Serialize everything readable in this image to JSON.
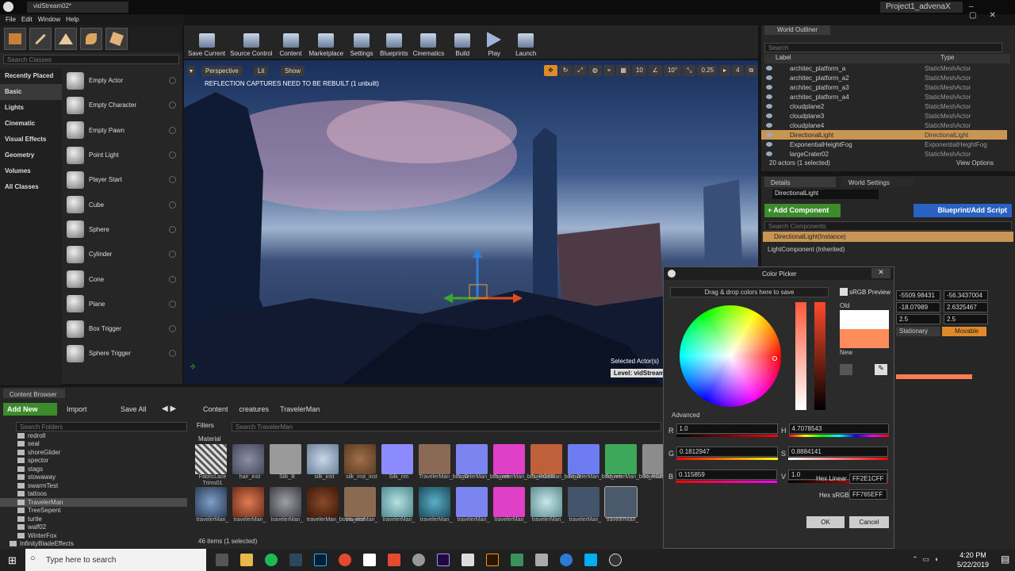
{
  "window": {
    "tab_title": "vidStream02*",
    "project": "Project1_advenaX"
  },
  "menu": [
    "File",
    "Edit",
    "Window",
    "Help"
  ],
  "place": {
    "search_placeholder": "Search Classes",
    "categories": [
      "Recently Placed",
      "Basic",
      "Lights",
      "Cinematic",
      "Visual Effects",
      "Geometry",
      "Volumes",
      "All Classes"
    ],
    "items": [
      "Empty Actor",
      "Empty Character",
      "Empty Pawn",
      "Point Light",
      "Player Start",
      "Cube",
      "Sphere",
      "Cylinder",
      "Cone",
      "Plane",
      "Box Trigger",
      "Sphere Trigger"
    ]
  },
  "toolbar": [
    "Save Current",
    "Source Control",
    "Content",
    "Marketplace",
    "Settings",
    "Blueprints",
    "Cinematics",
    "Build",
    "Play",
    "Launch"
  ],
  "viewport": {
    "perspective": "Perspective",
    "lit": "Lit",
    "show": "Show",
    "warning": "REFLECTION CAPTURES NEED TO BE REBUILT (1 unbuilt)",
    "grid": "10",
    "angle": "10°",
    "scale": "0.25",
    "cam": "4",
    "selected": "Selected Actor(s)",
    "level": "Level:  vidStream"
  },
  "outliner": {
    "tab": "World Outliner",
    "search": "Search",
    "col_label": "Label",
    "col_type": "Type",
    "rows": [
      {
        "label": "architec_platform_a",
        "type": "StaticMeshActor"
      },
      {
        "label": "architec_platform_a2",
        "type": "StaticMeshActor"
      },
      {
        "label": "architec_platform_a3",
        "type": "StaticMeshActor"
      },
      {
        "label": "architec_platform_a4",
        "type": "StaticMeshActor"
      },
      {
        "label": "cloudplane2",
        "type": "StaticMeshActor"
      },
      {
        "label": "cloudplane3",
        "type": "StaticMeshActor"
      },
      {
        "label": "cloudplane4",
        "type": "StaticMeshActor"
      },
      {
        "label": "DirectionalLight",
        "type": "DirectionalLight"
      },
      {
        "label": "ExponentialHeightFog",
        "type": "ExponentialHeightFog"
      },
      {
        "label": "largeCrater02",
        "type": "StaticMeshActor"
      }
    ],
    "status": "20 actors (1 selected)",
    "view_options": "View Options"
  },
  "details": {
    "tab_details": "Details",
    "tab_world": "World Settings",
    "name": "DirectionalLight",
    "add_component": "+ Add Component",
    "blueprint": "Blueprint/Add Script",
    "search_components": "Search Components",
    "instance": "DirectionalLight(Instance)",
    "light_component": "LightComponent (Inherited)",
    "loc": [
      "-5509.98431",
      "-56.3437004"
    ],
    "rot": [
      "-18.07989",
      "2.6325467"
    ],
    "scl": [
      "2.5",
      "2.5"
    ],
    "stationary": "Stationary",
    "movable": "Movable"
  },
  "content_browser": {
    "tab": "Content Browser",
    "add_new": "Add New",
    "import": "Import",
    "save_all": "Save All",
    "path": [
      "Content",
      "creatures",
      "TravelerMan"
    ],
    "search_folders": "Search Folders",
    "filters": "Filters",
    "search_asset": "Search TravelerMan",
    "material_header": "Material",
    "folders": [
      "redroll",
      "seal",
      "shoreGlider",
      "spector",
      "stags",
      "stowaway",
      "swarmTest",
      "tattoos",
      "TravelerMan",
      "TreeSepent",
      "turtle",
      "walf02",
      "WinterFox",
      "InfinityBladeEffects"
    ],
    "row1": [
      "FabricLace Trims01",
      "hair_inst",
      "Silk_B",
      "silk_inst",
      "silk_inst_inst",
      "Silk_nm",
      "TravelerMan_bits_D",
      "TravelerMan_bits_nm",
      "TravelerMan_bits_RGBA",
      "TravelerMan_bod_D",
      "TravelerMan_bod_nm",
      "TravelerMan_bod_RGBA",
      "TravelerMan_shield_"
    ],
    "row2": [
      "travelerMan_",
      "travelerMan_",
      "travelerMan_",
      "travelerMan_boots_inst",
      "travelerMan_",
      "travelerMan_",
      "travelerMan_",
      "travelerMan_",
      "travelerMan_",
      "travelerMan_",
      "travelerMan_",
      "travelerMan_"
    ],
    "status": "46 items (1 selected)"
  },
  "color_picker": {
    "title": "Color Picker",
    "drag_hint": "Drag & drop colors here to save",
    "srgb": "sRGB Preview",
    "old": "Old",
    "new": "New",
    "advanced": "Advanced",
    "r": "1.0",
    "g": "0.1812947",
    "b": "0.115859",
    "h": "4.7078543",
    "s": "0.8884141",
    "v": "1.0",
    "r_label": "R",
    "g_label": "G",
    "b_label": "B",
    "h_label": "H",
    "s_label": "S",
    "v_label": "V",
    "hex_linear_label": "Hex Linear",
    "hex_linear": "FF2E1CFF",
    "hex_srgb_label": "Hex sRGB",
    "hex_srgb": "FF765EFF",
    "ok": "OK",
    "cancel": "Cancel"
  },
  "taskbar": {
    "search": "Type here to search",
    "time": "4:20 PM",
    "date": "5/22/2019"
  },
  "colors": {
    "accent_green": "#3d8c2c",
    "accent_blue": "#2a62c4",
    "selection": "#c99555",
    "new_color": "#ff8c5a"
  }
}
